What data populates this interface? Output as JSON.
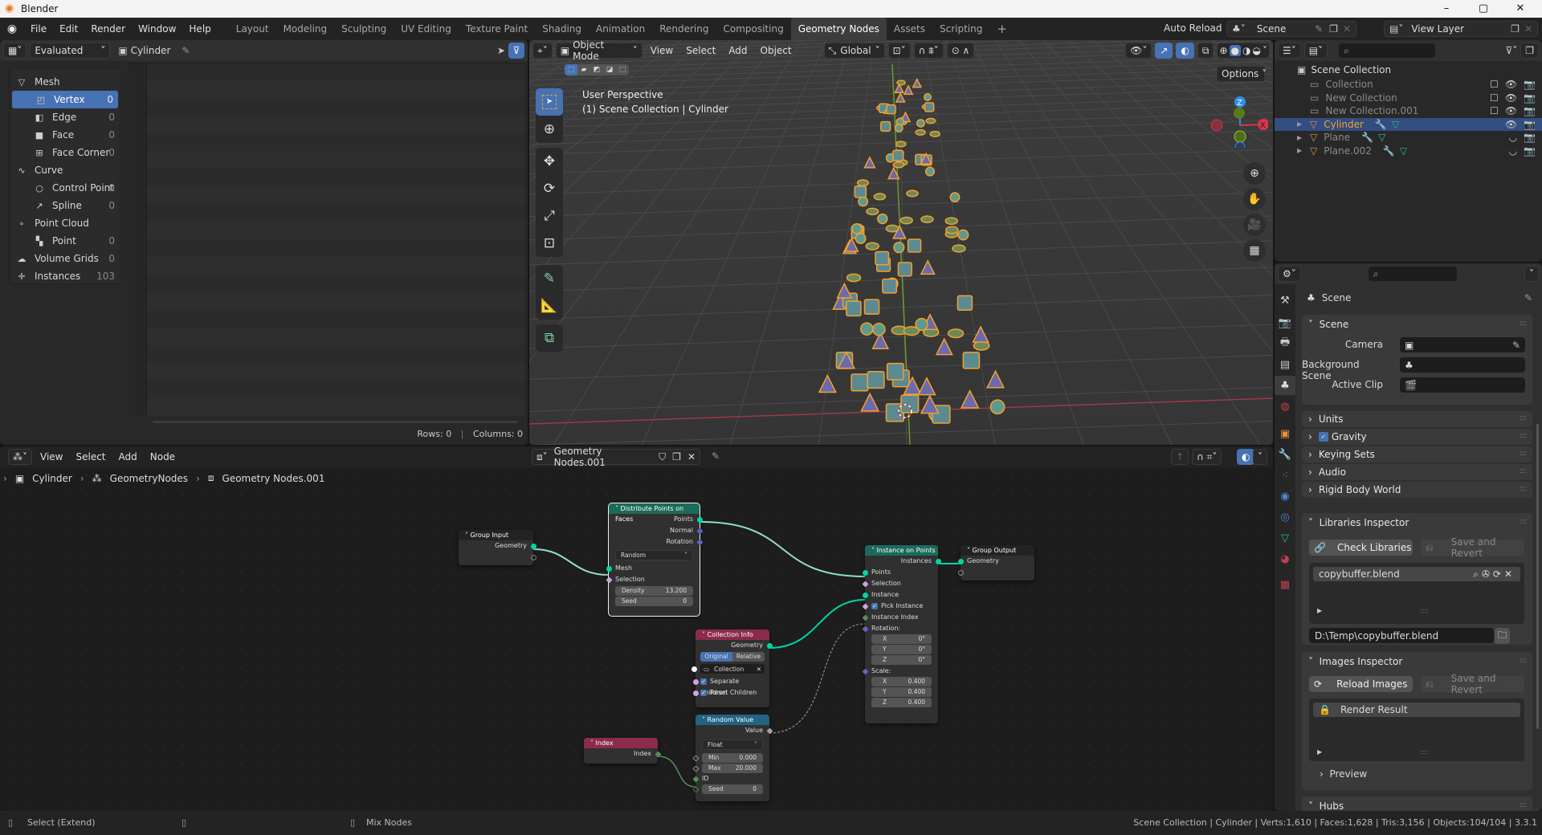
{
  "window": {
    "title": "Blender",
    "controls": {
      "minimize": "–",
      "maximize": "▢",
      "close": "✕"
    }
  },
  "topbar": {
    "menus": [
      "File",
      "Edit",
      "Render",
      "Window",
      "Help"
    ],
    "workspaces": [
      "Layout",
      "Modeling",
      "Sculpting",
      "UV Editing",
      "Texture Paint",
      "Shading",
      "Animation",
      "Rendering",
      "Compositing",
      "Geometry Nodes",
      "Assets",
      "Scripting"
    ],
    "active_workspace": "Geometry Nodes",
    "add_workspace": "+",
    "auto_reload": "Auto Reload",
    "scene": "Scene",
    "view_layer": "View Layer"
  },
  "spreadsheet": {
    "display_mode": "Evaluated",
    "object": "Cylinder",
    "sidebar": [
      {
        "label": "Mesh",
        "icon": "mesh-icon",
        "level": 0,
        "count": ""
      },
      {
        "label": "Vertex",
        "icon": "vertex-icon",
        "level": 1,
        "count": "0",
        "selected": true
      },
      {
        "label": "Edge",
        "icon": "edge-icon",
        "level": 1,
        "count": "0"
      },
      {
        "label": "Face",
        "icon": "face-icon",
        "level": 1,
        "count": "0"
      },
      {
        "label": "Face Corner",
        "icon": "face-corner-icon",
        "level": 1,
        "count": "0"
      },
      {
        "label": "Curve",
        "icon": "curve-icon",
        "level": 0,
        "count": ""
      },
      {
        "label": "Control Point",
        "icon": "control-point-icon",
        "level": 1,
        "count": "0"
      },
      {
        "label": "Spline",
        "icon": "spline-icon",
        "level": 1,
        "count": "0"
      },
      {
        "label": "Point Cloud",
        "icon": "point-cloud-icon",
        "level": 0,
        "count": ""
      },
      {
        "label": "Point",
        "icon": "point-icon",
        "level": 1,
        "count": "0"
      },
      {
        "label": "Volume Grids",
        "icon": "volume-icon",
        "level": 0,
        "count": "0"
      },
      {
        "label": "Instances",
        "icon": "instances-icon",
        "level": 0,
        "count": "103"
      }
    ],
    "footer": {
      "rows": "Rows: 0",
      "sep": "|",
      "columns": "Columns: 0"
    }
  },
  "viewport": {
    "mode": "Object Mode",
    "menus": [
      "View",
      "Select",
      "Add",
      "Object"
    ],
    "orientation": "Global",
    "options": "Options",
    "overlay_title": "User Perspective",
    "overlay_sub": "(1) Scene Collection | Cylinder",
    "gizmo": {
      "x": "X",
      "y": "Y",
      "z": "Z"
    }
  },
  "node_editor": {
    "menus": [
      "View",
      "Select",
      "Add",
      "Node"
    ],
    "node_group": "Geometry Nodes.001",
    "breadcrumb": [
      "Cylinder",
      "GeometryNodes",
      "Geometry Nodes.001"
    ],
    "nodes": {
      "group_input": {
        "title": "Group Input",
        "out": "Geometry"
      },
      "distribute": {
        "title": "Distribute Points on Faces",
        "outputs": [
          "Points",
          "Normal",
          "Rotation"
        ],
        "mode": "Random",
        "inputs": [
          "Mesh",
          "Selection"
        ],
        "density_label": "Density",
        "density": "13.200",
        "seed_label": "Seed",
        "seed": "0"
      },
      "instance_on_points": {
        "title": "Instance on Points",
        "out": "Instances",
        "inputs": [
          "Points",
          "Selection",
          "Instance"
        ],
        "pick_instance": "Pick Instance",
        "instance_index": "Instance Index",
        "rotation_label": "Rotation:",
        "rotation": [
          {
            "axis": "X",
            "value": "0°"
          },
          {
            "axis": "Y",
            "value": "0°"
          },
          {
            "axis": "Z",
            "value": "0°"
          }
        ],
        "scale_label": "Scale:",
        "scale": [
          {
            "axis": "X",
            "value": "0.400"
          },
          {
            "axis": "Y",
            "value": "0.400"
          },
          {
            "axis": "Z",
            "value": "0.400"
          }
        ]
      },
      "group_output": {
        "title": "Group Output",
        "in": "Geometry"
      },
      "collection_info": {
        "title": "Collection Info",
        "out": "Geometry",
        "toggle": [
          "Original",
          "Relative"
        ],
        "collection": "Collection",
        "separate_children": "Separate Children",
        "reset_children": "Reset Children"
      },
      "random_value": {
        "title": "Random Value",
        "out": "Value",
        "type": "Float",
        "min_label": "Min",
        "min": "0.000",
        "max_label": "Max",
        "max": "20.000",
        "id": "ID",
        "seed_label": "Seed",
        "seed": "0"
      },
      "index": {
        "title": "Index",
        "out": "Index"
      }
    }
  },
  "outliner": {
    "root": "Scene Collection",
    "items": [
      {
        "label": "Collection",
        "type": "collection"
      },
      {
        "label": "New Collection",
        "type": "collection"
      },
      {
        "label": "New Collection.001",
        "type": "collection"
      },
      {
        "label": "Cylinder",
        "type": "object",
        "selected": true
      },
      {
        "label": "Plane",
        "type": "object"
      },
      {
        "label": "Plane.002",
        "type": "object"
      }
    ]
  },
  "properties": {
    "context": "Scene",
    "scene_panel": {
      "title": "Scene",
      "camera": "Camera",
      "background_scene": "Background Scene",
      "active_clip": "Active Clip"
    },
    "collapsed_panels": [
      "Units",
      "Gravity",
      "Keying Sets",
      "Audio",
      "Rigid Body World"
    ],
    "libraries": {
      "title": "Libraries Inspector",
      "check": "Check Libraries",
      "save_revert": "Save and Revert",
      "item": "copybuffer.blend",
      "path": "D:\\Temp\\copybuffer.blend"
    },
    "images": {
      "title": "Images Inspector",
      "reload": "Reload Images",
      "save_revert": "Save and Revert",
      "item": "Render Result",
      "preview": "Preview"
    },
    "hubs": "Hubs"
  },
  "status": {
    "left": "Select (Extend)",
    "middle": "Mix Nodes",
    "right": "Scene Collection | Cylinder | Verts:1,610 | Faces:1,628 | Tris:3,156 | Objects:104/104 | 3.3.1"
  },
  "colors": {
    "accent": "#4772b3",
    "selection": "#f5a02b",
    "geometry_socket": "#00d6a3",
    "float_socket": "#a1a1a1",
    "vector_socket": "#6363c7",
    "bool_socket": "#cca6d6",
    "int_socket": "#598c5c"
  }
}
